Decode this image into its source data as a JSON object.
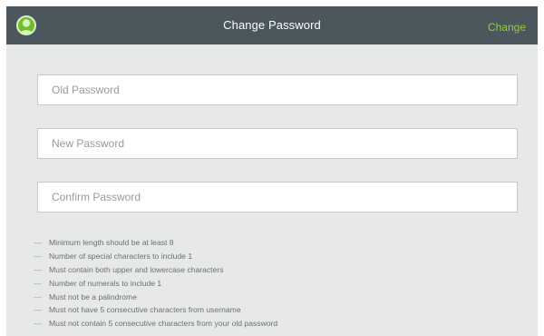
{
  "header": {
    "title": "Change Password",
    "action_label": "Change",
    "avatar_icon": "user-avatar-icon",
    "colors": {
      "bar": "#4b565d",
      "accent": "#8fd13d",
      "avatar": "#6fbf2a"
    }
  },
  "form": {
    "old_password": {
      "placeholder": "Old Password",
      "value": ""
    },
    "new_password": {
      "placeholder": "New Password",
      "value": ""
    },
    "confirm_password": {
      "placeholder": "Confirm Password",
      "value": ""
    }
  },
  "rules": {
    "bullet": "—",
    "items": [
      "Minimum length should be at least 8",
      "Number of special characters to include 1",
      "Must contain both upper and lowercase characters",
      "Number of numerals to include 1",
      "Must not be a palindrome",
      "Must not have 5 consecutive characters from username",
      "Must not contain 5 consecutive characters from your old password"
    ]
  }
}
